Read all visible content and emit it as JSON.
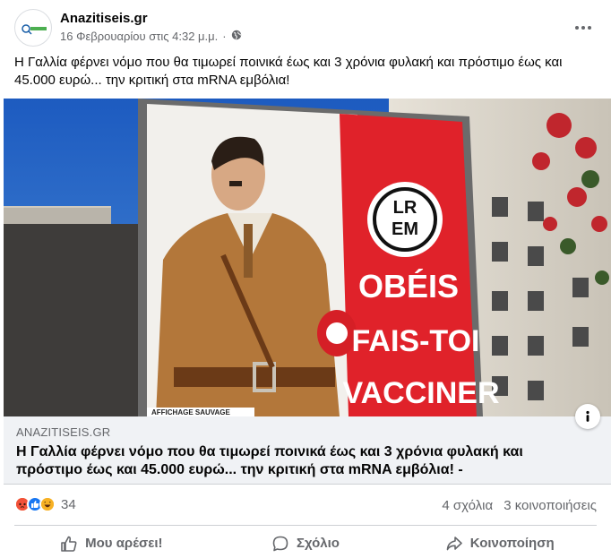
{
  "post": {
    "author": "Anazitiseis.gr",
    "date": "16 Φεβρουαρίου στις 4:32 μ.μ.",
    "separator": "·",
    "text": "Η Γαλλία φέρνει νόμο που θα τιμωρεί ποινικά έως και 3 χρόνια φυλακή και πρόστιμο έως και 45.000 ευρώ... την κριτική στα mRNA εμβόλια!"
  },
  "image": {
    "billboard_word1": "OBÉIS",
    "billboard_word2": "FAIS-TOI",
    "billboard_word3": "VACCINER",
    "poster_footer": "AFFICHAGE SAUVAGE"
  },
  "link": {
    "domain": "ANAZITISEIS.GR",
    "title": "Η Γαλλία φέρνει νόμο που θα τιμωρεί ποινικά έως και 3 χρόνια φυλακή και πρόστιμο έως και 45.000 ευρώ... την κριτική στα mRNA εμβόλια! -"
  },
  "stats": {
    "reaction_icons": [
      "angry-icon",
      "like-icon",
      "haha-icon"
    ],
    "reaction_count": "34",
    "comments": "4 σχόλια",
    "shares": "3 κοινοποιήσεις"
  },
  "actions": {
    "like": "Μου αρέσει!",
    "comment": "Σχόλιο",
    "share": "Κοινοποίηση"
  },
  "colors": {
    "angry": "#e9710f",
    "like": "#1877f2",
    "haha": "#f7b125",
    "secondary_text": "#65676b",
    "billboard_red": "#e0222a"
  }
}
